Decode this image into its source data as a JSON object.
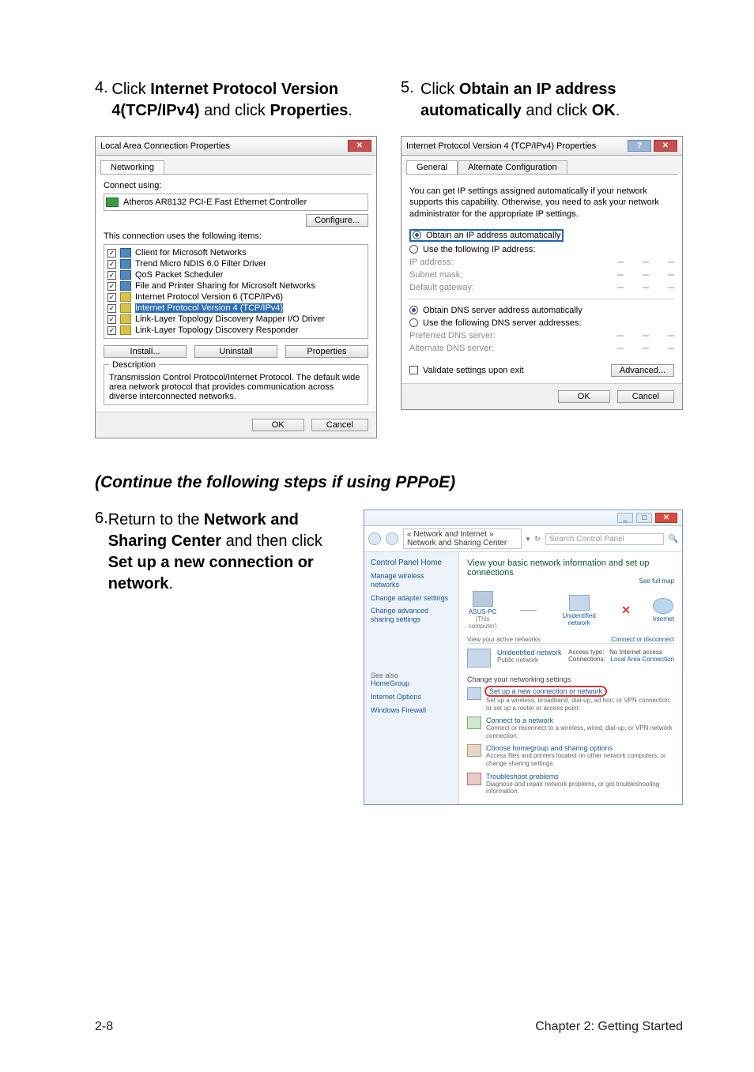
{
  "step4": {
    "num": "4.",
    "pre": "Click ",
    "bold1": "Internet Protocol Version 4(TCP/IPv4)",
    "mid": " and click ",
    "bold2": "Properties",
    "post": "."
  },
  "step5": {
    "num": "5.",
    "pre": "Click ",
    "bold1": "Obtain an IP address automatically",
    "mid": " and click ",
    "bold2": "OK",
    "post": "."
  },
  "lac": {
    "title": "Local Area Connection Properties",
    "tab": "Networking",
    "connect_label": "Connect using:",
    "adapter": "Atheros AR8132 PCI-E Fast Ethernet Controller",
    "configure": "Configure...",
    "uses_label": "This connection uses the following items:",
    "items": [
      "Client for Microsoft Networks",
      "Trend Micro NDIS 6.0 Filter Driver",
      "QoS Packet Scheduler",
      "File and Printer Sharing for Microsoft Networks",
      "Internet Protocol Version 6 (TCP/IPv6)",
      "Internet Protocol Version 4 (TCP/IPv4)",
      "Link-Layer Topology Discovery Mapper I/O Driver",
      "Link-Layer Topology Discovery Responder"
    ],
    "install": "Install...",
    "uninstall": "Uninstall",
    "properties": "Properties",
    "desc_label": "Description",
    "desc": "Transmission Control Protocol/Internet Protocol. The default wide area network protocol that provides communication across diverse interconnected networks.",
    "ok": "OK",
    "cancel": "Cancel"
  },
  "ipv4": {
    "title": "Internet Protocol Version 4 (TCP/IPv4) Properties",
    "tab_general": "General",
    "tab_alt": "Alternate Configuration",
    "note": "You can get IP settings assigned automatically if your network supports this capability. Otherwise, you need to ask your network administrator for the appropriate IP settings.",
    "r_auto": "Obtain an IP address automatically",
    "r_use": "Use the following IP address:",
    "ip": "IP address:",
    "mask": "Subnet mask:",
    "gw": "Default gateway:",
    "r_dns_auto": "Obtain DNS server address automatically",
    "r_dns_use": "Use the following DNS server addresses:",
    "pdns": "Preferred DNS server:",
    "adns": "Alternate DNS server:",
    "validate": "Validate settings upon exit",
    "advanced": "Advanced...",
    "ok": "OK",
    "cancel": "Cancel"
  },
  "continue_heading": "(Continue the following steps if using PPPoE)",
  "step6": {
    "num": "6.",
    "pre": "Return to the ",
    "bold1": "Network and Sharing Center",
    "mid": " and then click ",
    "bold2": "Set up a new connection or network",
    "post": "."
  },
  "nsc": {
    "breadcrumb": "« Network and Internet » Network and Sharing Center",
    "search_placeholder": "Search Control Panel",
    "sidebar_home": "Control Panel Home",
    "sidebar_links": [
      "Manage wireless networks",
      "Change adapter settings",
      "Change advanced sharing settings"
    ],
    "see_also": "See also",
    "see_links": [
      "HomeGroup",
      "Internet Options",
      "Windows Firewall"
    ],
    "view_heading": "View your basic network information and set up connections",
    "seefull": "See full map",
    "nodes": {
      "pc": "ASUS-PC",
      "pc2": "(This computer)",
      "net": "Unidentified network",
      "inet": "Internet"
    },
    "active_label": "View your active networks",
    "active_name": "Unidentified network",
    "active_type": "Public network",
    "access": "Access type:",
    "access_v": "No Internet access",
    "conns": "Connections:",
    "conns_v": "Local Area Connection",
    "connect_disc": "Connect or disconnect",
    "change_label": "Change your networking settings",
    "tasks": [
      {
        "t": "Set up a new connection or network",
        "d": "Set up a wireless, broadband, dial-up, ad hoc, or VPN connection; or set up a router or access point."
      },
      {
        "t": "Connect to a network",
        "d": "Connect or reconnect to a wireless, wired, dial-up, or VPN network connection."
      },
      {
        "t": "Choose homegroup and sharing options",
        "d": "Access files and printers located on other network computers, or change sharing settings."
      },
      {
        "t": "Troubleshoot problems",
        "d": "Diagnose and repair network problems, or get troubleshooting information."
      }
    ]
  },
  "footer": {
    "left": "2-8",
    "right": "Chapter 2: Getting Started"
  }
}
